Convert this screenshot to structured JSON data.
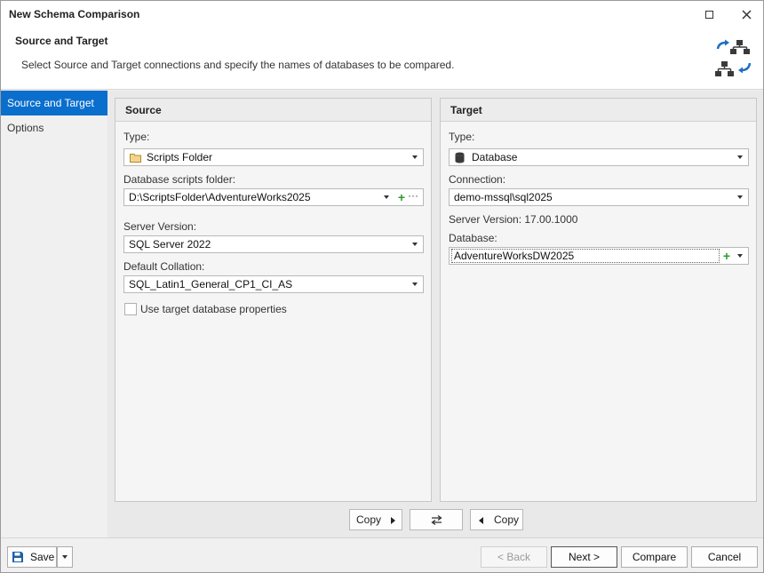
{
  "window": {
    "title": "New Schema Comparison"
  },
  "header": {
    "title": "Source and Target",
    "description": "Select Source and Target connections and specify the names of databases to be compared."
  },
  "sidebar": {
    "items": [
      {
        "label": "Source and Target",
        "active": true
      },
      {
        "label": "Options",
        "active": false
      }
    ]
  },
  "source": {
    "title": "Source",
    "type_label": "Type:",
    "type_value": "Scripts Folder",
    "folder_label": "Database scripts folder:",
    "folder_value": "D:\\ScriptsFolder\\AdventureWorks2025",
    "server_version_label": "Server Version:",
    "server_version_value": "SQL Server 2022",
    "collation_label": "Default Collation:",
    "collation_value": "SQL_Latin1_General_CP1_CI_AS",
    "use_target_label": "Use target database properties",
    "use_target_checked": false
  },
  "target": {
    "title": "Target",
    "type_label": "Type:",
    "type_value": "Database",
    "connection_label": "Connection:",
    "connection_value": "demo-mssql\\sql2025",
    "server_version_text": "Server Version: 17.00.1000",
    "database_label": "Database:",
    "database_value": "AdventureWorksDW2025"
  },
  "middle": {
    "copy_right_label": "Copy",
    "copy_left_label": "Copy"
  },
  "footer": {
    "save_label": "Save",
    "back_label": "< Back",
    "next_label": "Next >",
    "compare_label": "Compare",
    "cancel_label": "Cancel"
  },
  "colors": {
    "accent": "#0a6ecd",
    "plus": "#2e9c2e",
    "icon_blue": "#1e6fc0",
    "icon_dark": "#3a3a3a"
  }
}
